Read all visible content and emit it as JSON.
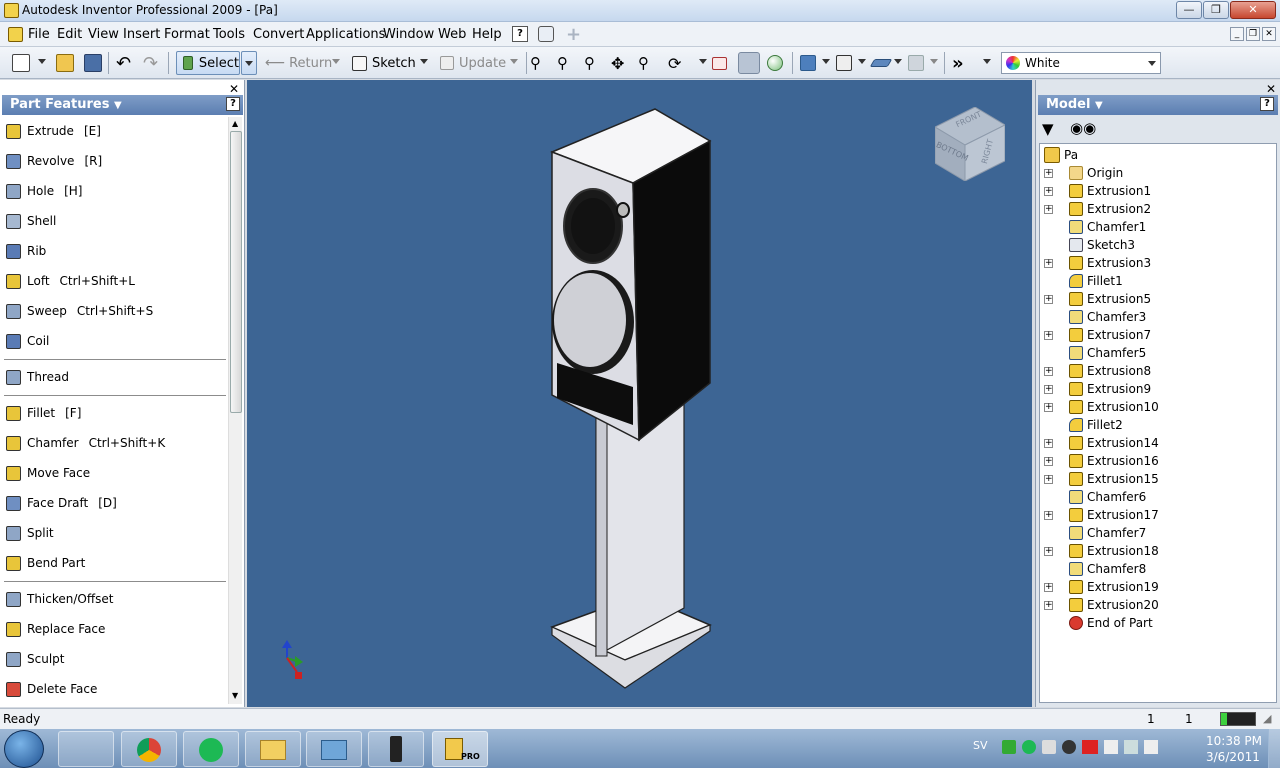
{
  "window": {
    "title": "Autodesk Inventor Professional 2009 - [Pa]"
  },
  "menu": [
    "File",
    "Edit",
    "View",
    "Insert",
    "Format",
    "Tools",
    "Convert",
    "Applications",
    "Window",
    "Web",
    "Help"
  ],
  "toolbar": {
    "select_label": "Select",
    "return_label": "Return",
    "sketch_label": "Sketch",
    "update_label": "Update",
    "color_label": "White"
  },
  "left_panel": {
    "title": "Part Features",
    "features": [
      {
        "label": "Extrude",
        "shortcut": "[E]"
      },
      {
        "label": "Revolve",
        "shortcut": "[R]"
      },
      {
        "label": "Hole",
        "shortcut": "[H]"
      },
      {
        "label": "Shell",
        "shortcut": ""
      },
      {
        "label": "Rib",
        "shortcut": ""
      },
      {
        "label": "Loft",
        "shortcut": "Ctrl+Shift+L"
      },
      {
        "label": "Sweep",
        "shortcut": "Ctrl+Shift+S"
      },
      {
        "label": "Coil",
        "shortcut": ""
      },
      {
        "label": "Thread",
        "shortcut": ""
      },
      {
        "label": "Fillet",
        "shortcut": "[F]"
      },
      {
        "label": "Chamfer",
        "shortcut": "Ctrl+Shift+K"
      },
      {
        "label": "Move Face",
        "shortcut": ""
      },
      {
        "label": "Face Draft",
        "shortcut": "[D]"
      },
      {
        "label": "Split",
        "shortcut": ""
      },
      {
        "label": "Bend Part",
        "shortcut": ""
      },
      {
        "label": "Thicken/Offset",
        "shortcut": ""
      },
      {
        "label": "Replace Face",
        "shortcut": ""
      },
      {
        "label": "Sculpt",
        "shortcut": ""
      },
      {
        "label": "Delete Face",
        "shortcut": ""
      }
    ]
  },
  "viewcube": {
    "front": "FRONT",
    "right": "RIGHT",
    "bottom": "BOTTOM"
  },
  "right_panel": {
    "title": "Model",
    "root": "Pa",
    "nodes": [
      {
        "label": "Origin",
        "type": "folder",
        "expand": true
      },
      {
        "label": "Extrusion1",
        "type": "extrusion",
        "expand": true
      },
      {
        "label": "Extrusion2",
        "type": "extrusion",
        "expand": true
      },
      {
        "label": "Chamfer1",
        "type": "chamfer",
        "expand": false
      },
      {
        "label": "Sketch3",
        "type": "sketch",
        "expand": false
      },
      {
        "label": "Extrusion3",
        "type": "extrusion",
        "expand": true
      },
      {
        "label": "Fillet1",
        "type": "fillet",
        "expand": false
      },
      {
        "label": "Extrusion5",
        "type": "extrusion",
        "expand": true
      },
      {
        "label": "Chamfer3",
        "type": "chamfer",
        "expand": false
      },
      {
        "label": "Extrusion7",
        "type": "extrusion",
        "expand": true
      },
      {
        "label": "Chamfer5",
        "type": "chamfer",
        "expand": false
      },
      {
        "label": "Extrusion8",
        "type": "extrusion",
        "expand": true
      },
      {
        "label": "Extrusion9",
        "type": "extrusion",
        "expand": true
      },
      {
        "label": "Extrusion10",
        "type": "extrusion",
        "expand": true
      },
      {
        "label": "Fillet2",
        "type": "fillet",
        "expand": false
      },
      {
        "label": "Extrusion14",
        "type": "extrusion",
        "expand": true
      },
      {
        "label": "Extrusion16",
        "type": "extrusion",
        "expand": true
      },
      {
        "label": "Extrusion15",
        "type": "extrusion",
        "expand": true
      },
      {
        "label": "Chamfer6",
        "type": "chamfer",
        "expand": false
      },
      {
        "label": "Extrusion17",
        "type": "extrusion",
        "expand": true
      },
      {
        "label": "Chamfer7",
        "type": "chamfer",
        "expand": false
      },
      {
        "label": "Extrusion18",
        "type": "extrusion",
        "expand": true
      },
      {
        "label": "Chamfer8",
        "type": "chamfer",
        "expand": false
      },
      {
        "label": "Extrusion19",
        "type": "extrusion",
        "expand": true
      },
      {
        "label": "Extrusion20",
        "type": "extrusion",
        "expand": true
      },
      {
        "label": "End of Part",
        "type": "end",
        "expand": false
      }
    ]
  },
  "status": {
    "text": "Ready",
    "count1": "1",
    "count2": "1"
  },
  "taskbar": {
    "lang": "SV",
    "time": "10:38 PM",
    "date": "3/6/2011",
    "pro_label": "PRO"
  },
  "colors": {
    "viewport_bg": "#3d6594",
    "panel_header": "#6b8cbd",
    "feature_icon": "#e8c53a"
  }
}
